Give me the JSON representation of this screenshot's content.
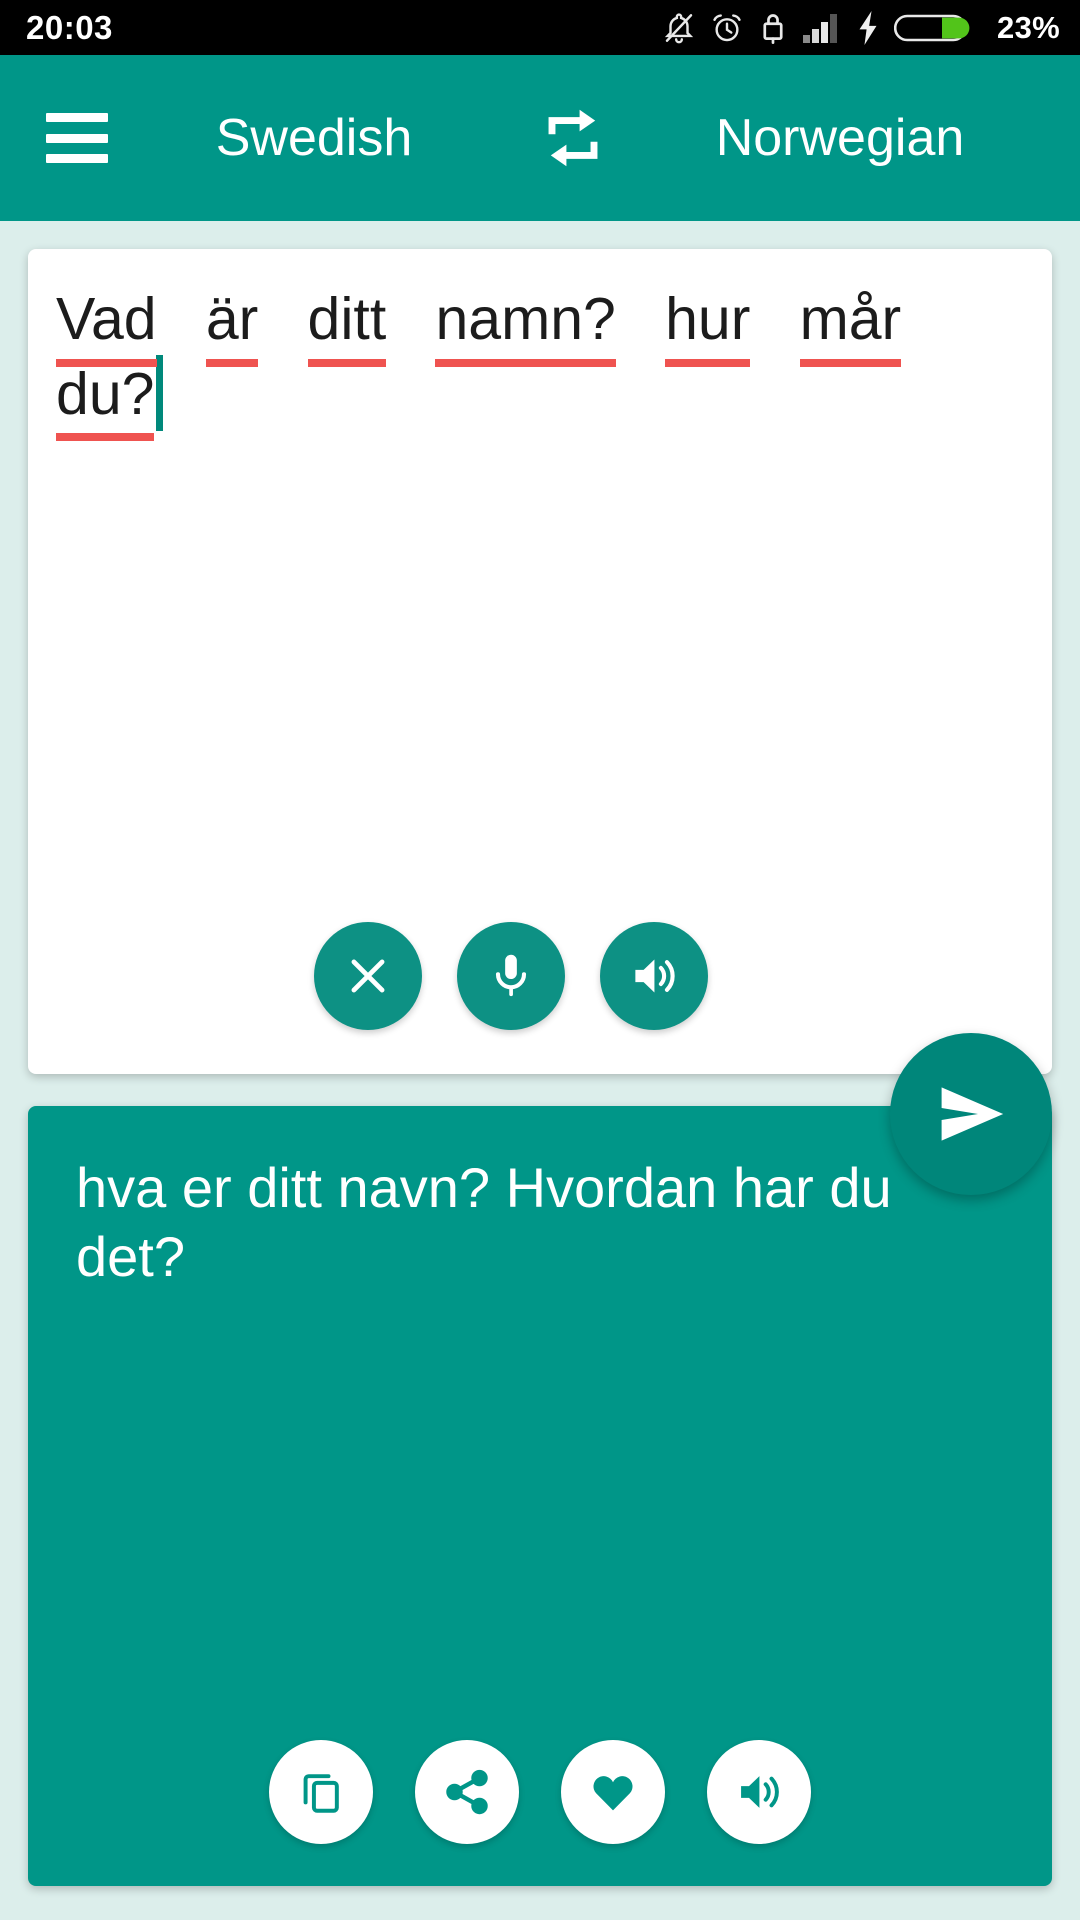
{
  "statusbar": {
    "time": "20:03",
    "battery_percent": "23%",
    "icons": [
      "bell-off-icon",
      "alarm-clock-icon",
      "lock-icon",
      "signal-bars-icon",
      "charging-bolt-icon",
      "battery-icon"
    ],
    "background_color": "#000000",
    "text_color": "#FFFFFF",
    "battery_fill_color": "#52C41A"
  },
  "appbar": {
    "menu_icon": "hamburger-menu-icon",
    "source_language": "Swedish",
    "swap_icon": "swap-languages-icon",
    "target_language": "Norwegian",
    "background_color": "#009688",
    "text_color": "#FFFFFF"
  },
  "input_card": {
    "text": "Vad är ditt namn? hur mår du?",
    "words": [
      "Vad",
      "är",
      "ditt",
      "namn?",
      "hur",
      "mår",
      "du?"
    ],
    "spellcheck_underline_color": "#EF5350",
    "caret_color": "#00897B",
    "background_color": "#FFFFFF",
    "text_color": "#1C1C1C",
    "actions": [
      {
        "name": "clear-button",
        "icon": "close-icon",
        "label": "Clear"
      },
      {
        "name": "mic-button",
        "icon": "microphone-icon",
        "label": "Voice input"
      },
      {
        "name": "speak-input-button",
        "icon": "speaker-icon",
        "label": "Speak"
      }
    ]
  },
  "send_button": {
    "name": "send-button",
    "icon": "send-icon",
    "label": "Translate",
    "background_color": "#00867A"
  },
  "output_card": {
    "text": "hva er ditt navn? Hvordan har du det?",
    "background_color": "#009688",
    "text_color": "#FFFFFF",
    "actions": [
      {
        "name": "copy-button",
        "icon": "copy-icon",
        "label": "Copy"
      },
      {
        "name": "share-button",
        "icon": "share-icon",
        "label": "Share"
      },
      {
        "name": "favorite-button",
        "icon": "heart-icon",
        "label": "Favorite"
      },
      {
        "name": "speak-output-button",
        "icon": "speaker-icon",
        "label": "Speak"
      }
    ]
  },
  "page": {
    "background_color": "#DCEEEB"
  }
}
